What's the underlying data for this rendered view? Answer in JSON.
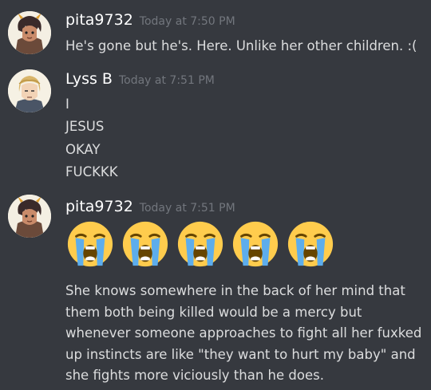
{
  "messages": [
    {
      "username": "pita9732",
      "timestamp": "Today at 7:50 PM",
      "lines": [
        "He's gone but he's. Here. Unlike her other children. :("
      ]
    },
    {
      "username": "Lyss B",
      "timestamp": "Today at 7:51 PM",
      "lines": [
        "I",
        "JESUS",
        "OKAY",
        "FUCKKK"
      ]
    },
    {
      "username": "pita9732",
      "timestamp": "Today at 7:51 PM",
      "emoji": [
        "loudly-crying-face",
        "loudly-crying-face",
        "loudly-crying-face",
        "loudly-crying-face",
        "loudly-crying-face"
      ],
      "text": "She knows somewhere in the back of her mind that them both being killed would be a mercy but whenever someone approaches to fight all her fuxked up instincts are like \"they want to hurt my baby\" and she fights more viciously than he does."
    }
  ],
  "colors": {
    "background": "#36393f",
    "text": "#dcddde",
    "username": "#ffffff",
    "timestamp": "#72767d"
  }
}
